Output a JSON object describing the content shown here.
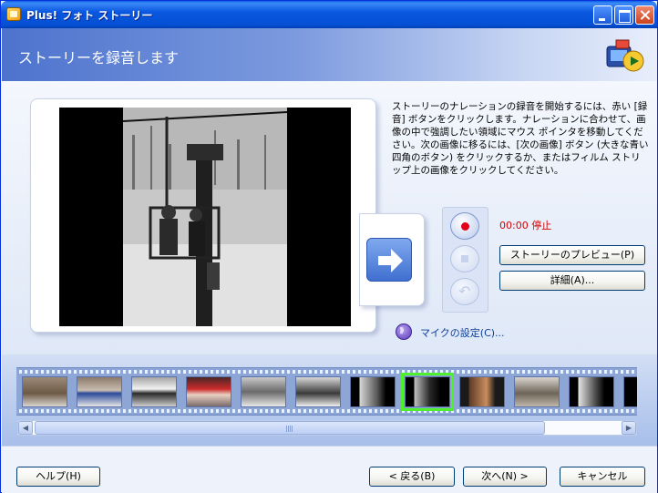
{
  "window": {
    "title": "Plus! フォト ストーリー"
  },
  "header": {
    "title": "ストーリーを録音します"
  },
  "instructions": "ストーリーのナレーションの録音を開始するには、赤い [録音] ボタンをクリックします。ナレーションに合わせて、画像の中で強調したい領域にマウス ポインタを移動してください。次の画像に移るには、[次の画像] ボタン (大きな青い四角のボタン) をクリックするか、またはフィルム ストリップ上の画像をクリックしてください。",
  "recording": {
    "status": "00:00 停止"
  },
  "buttons": {
    "preview": "ストーリーのプレビュー(P)",
    "details": "詳細(A)...",
    "help": "ヘルプ(H)",
    "back": "< 戻る(B)",
    "next": "次へ(N) >",
    "cancel": "キャンセル"
  },
  "mic": {
    "label": "マイクの設定(C)..."
  },
  "icons": {
    "app": "photo-story-app-icon",
    "next_image": "right-arrow-icon",
    "record": "record-icon",
    "stop": "stop-icon",
    "undo": "undo-icon",
    "mic": "microphone-icon"
  },
  "filmstrip": {
    "thumbnail_count": 13,
    "selected_index": 7
  },
  "colors": {
    "accent": "#0a5ee8",
    "status": "#d40000",
    "selection": "#4ef02b"
  }
}
